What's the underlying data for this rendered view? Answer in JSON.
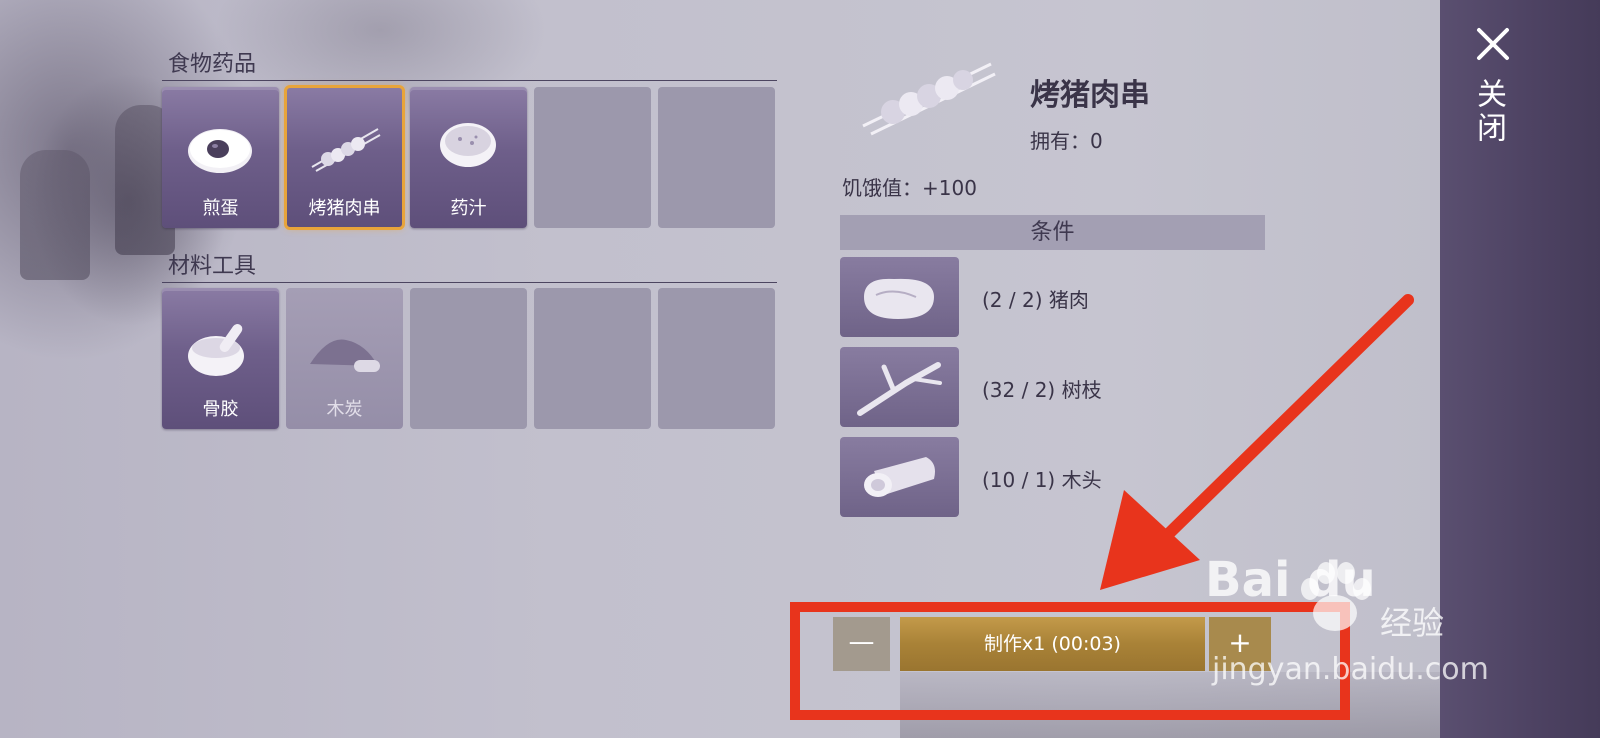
{
  "categories": [
    {
      "title": "食物药品",
      "items": [
        {
          "label": "煎蛋",
          "icon": "fried-egg-icon",
          "state": "filled"
        },
        {
          "label": "烤猪肉串",
          "icon": "pork-skewer-icon",
          "state": "selected"
        },
        {
          "label": "药汁",
          "icon": "medicine-bowl-icon",
          "state": "filled"
        },
        {
          "label": "",
          "icon": "",
          "state": "empty"
        },
        {
          "label": "",
          "icon": "",
          "state": "empty"
        }
      ]
    },
    {
      "title": "材料工具",
      "items": [
        {
          "label": "骨胶",
          "icon": "mortar-bowl-icon",
          "state": "filled"
        },
        {
          "label": "木炭",
          "icon": "charcoal-icon",
          "state": "dim"
        },
        {
          "label": "",
          "icon": "",
          "state": "empty"
        },
        {
          "label": "",
          "icon": "",
          "state": "empty"
        },
        {
          "label": "",
          "icon": "",
          "state": "empty"
        }
      ]
    }
  ],
  "detail": {
    "name": "烤猪肉串",
    "owned_label": "拥有：",
    "owned_value": "0",
    "hunger_label": "饥饿值：",
    "hunger_value": "+100",
    "conditions_title": "条件",
    "requirements": [
      {
        "count": "(2 / 2)",
        "name": "猪肉",
        "icon": "pork-meat-icon"
      },
      {
        "count": "(32 / 2)",
        "name": "树枝",
        "icon": "branch-icon"
      },
      {
        "count": "(10 / 1)",
        "name": "木头",
        "icon": "wood-log-icon"
      }
    ]
  },
  "craft": {
    "minus_label": "—",
    "button_label": "制作x1 (00:03)",
    "plus_label": "+"
  },
  "sidebar": {
    "close_label": "关闭"
  },
  "watermark": {
    "logo": "Bai  du",
    "jingyan": "经验",
    "url": "jingyan.baidu.com"
  },
  "colors": {
    "accent_annotation": "#e8341c",
    "selected_outline": "#e8a43a",
    "craft_button": "#a98237"
  }
}
